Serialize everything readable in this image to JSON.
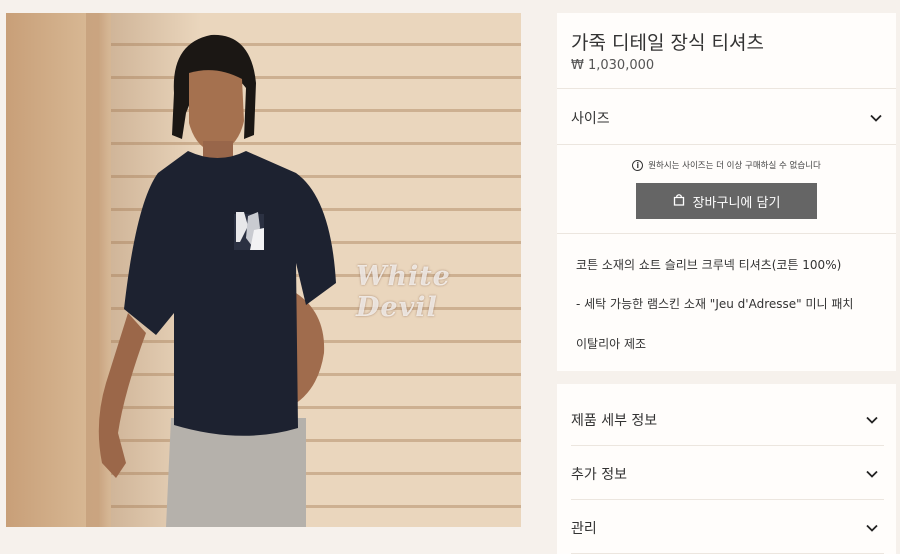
{
  "product": {
    "title": "가죽 디테일 장식 티셔츠",
    "price": "₩ 1,030,000",
    "image_watermark": "White Devil"
  },
  "size_selector": {
    "label": "사이즈",
    "icon": "chevron-down-icon"
  },
  "availability": {
    "icon": "info-icon",
    "message": "원하시는 사이즈는 더 이상 구매하실 수 없습니다"
  },
  "cart": {
    "icon": "shopping-bag-icon",
    "label": "장바구니에 담기"
  },
  "description": [
    "코튼 소재의 쇼트 슬리브 크루넥 티셔츠(코튼 100%)",
    "- 세탁 가능한 램스킨 소재 \"Jeu d'Adresse\" 미니 패치",
    "이탈리아 제조"
  ],
  "accordions": [
    {
      "label": "제품 세부 정보"
    },
    {
      "label": "추가 정보"
    },
    {
      "label": "관리"
    }
  ],
  "colors": {
    "button_bg": "#656565",
    "page_bg": "#f6f1ec",
    "card_bg": "#fffdfb"
  }
}
